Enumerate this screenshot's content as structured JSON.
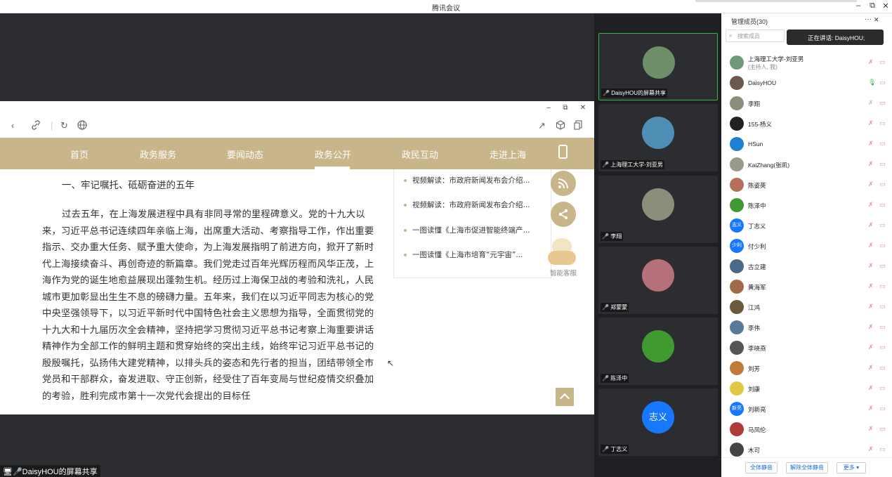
{
  "window": {
    "title": "腾讯会议",
    "min": "–",
    "max": "⧉",
    "close": "✕"
  },
  "browser": {
    "win_min": "–",
    "win_max": "⧉",
    "win_close": "✕",
    "nav": [
      "首页",
      "政务服务",
      "要闻动态",
      "政务公开",
      "政民互动",
      "走进上海"
    ],
    "article_heading": "一、牢记嘱托、砥砺奋进的五年",
    "article_body": "过去五年，在上海发展进程中具有非同寻常的里程碑意义。党的十九大以来，习近平总书记连续四年亲临上海，出席重大活动、考察指导工作，作出重要指示、交办重大任务、赋予重大使命，为上海发展指明了前进方向，掀开了新时代上海接续奋斗、再创奇迹的新篇章。我们党走过百年光辉历程而风华正茂，上海作为党的诞生地愈益展现出蓬勃生机。经历过上海保卫战的考验和洗礼，人民城市更加彰显出生生不息的磅礴力量。五年来，我们在以习近平同志为核心的党中央坚强领导下，以习近平新时代中国特色社会主义思想为指导，全面贯彻党的十九大和十九届历次全会精神，坚持把学习贯彻习近平总书记考察上海重要讲话精神作为全部工作的鲜明主题和贯穿始终的突出主线，始终牢记习近平总书记的殷殷嘱托，弘扬伟大建党精神，以排头兵的姿态和先行者的担当，团结带领全市党员和干部群众，奋发进取、守正创新，经受住了百年变局与世纪疫情交织叠加的考验，胜利完成市第十一次党代会提出的目标任",
    "related": [
      "视频解读：市政府新闻发布会介绍...",
      "视频解读：市政府新闻发布会介绍...",
      "一图读懂《上海市促进智能终端产...",
      "一图读懂《上海市培育“元宇宙”..."
    ],
    "bot_label": "智能客服"
  },
  "share_badge": "DaisyHOU的屏幕共享",
  "video_tiles": [
    {
      "name": "DaisyHOU的屏幕共享",
      "color": "#6f8f6a"
    },
    {
      "name": "上海理工大学-刘亚男",
      "color": "#4f8fb5"
    },
    {
      "name": "李翔",
      "color": "#8a8f7a"
    },
    {
      "name": "郑蒙蒙",
      "color": "#b5707a"
    },
    {
      "name": "陈泽中",
      "color": "#3f9a2f"
    },
    {
      "name": "丁志义",
      "label": "志义",
      "color": "#1677ff"
    }
  ],
  "panel": {
    "title": "管理成员(30)",
    "more": "···",
    "close": "✕",
    "search_placeholder": "搜索成员",
    "speaking": "正在讲话: DaisyHOU;",
    "members": [
      {
        "name": "上海理工大学-刘亚男",
        "sub": "(主持人, 我)",
        "color": "#6f9a7a",
        "mic": "muted"
      },
      {
        "name": "DaisyHOU",
        "color": "#6b5a4a",
        "mic": "on"
      },
      {
        "name": "李翔",
        "color": "#8a8f7a",
        "mic": "grey"
      },
      {
        "name": "155-杨义",
        "color": "#222222",
        "mic": "muted"
      },
      {
        "name": "HSun",
        "color": "#1f7fd0",
        "mic": "muted"
      },
      {
        "name": "KaiZhang(张凯)",
        "color": "#9a9a8a",
        "mic": "muted"
      },
      {
        "name": "陈姿英",
        "color": "#b5705a",
        "mic": "muted"
      },
      {
        "name": "陈泽中",
        "color": "#3f9a2f",
        "mic": "muted"
      },
      {
        "name": "丁志义",
        "label": "志义",
        "color": "#1677ff",
        "mic": "muted"
      },
      {
        "name": "付少利",
        "label": "少利",
        "color": "#1677ff",
        "mic": "muted"
      },
      {
        "name": "古立建",
        "color": "#4a6a8a",
        "mic": "muted"
      },
      {
        "name": "黄海军",
        "color": "#a06a4a",
        "mic": "muted"
      },
      {
        "name": "江鸿",
        "color": "#6a5a3a",
        "mic": "muted"
      },
      {
        "name": "李伟",
        "color": "#5a7a9a",
        "mic": "muted"
      },
      {
        "name": "李晓燕",
        "color": "#555555",
        "mic": "muted"
      },
      {
        "name": "刘芳",
        "color": "#c07a3a",
        "mic": "muted"
      },
      {
        "name": "刘康",
        "color": "#e0c840",
        "mic": "muted"
      },
      {
        "name": "刘新亮",
        "label": "新亮",
        "color": "#1677ff",
        "mic": "muted"
      },
      {
        "name": "马凤伦",
        "color": "#b03a3a",
        "mic": "muted"
      },
      {
        "name": "木可",
        "color": "#444444",
        "mic": "muted"
      }
    ],
    "footer": {
      "mute_all": "全体静音",
      "unmute_all": "解除全体静音",
      "more": "更多 ▾"
    }
  }
}
